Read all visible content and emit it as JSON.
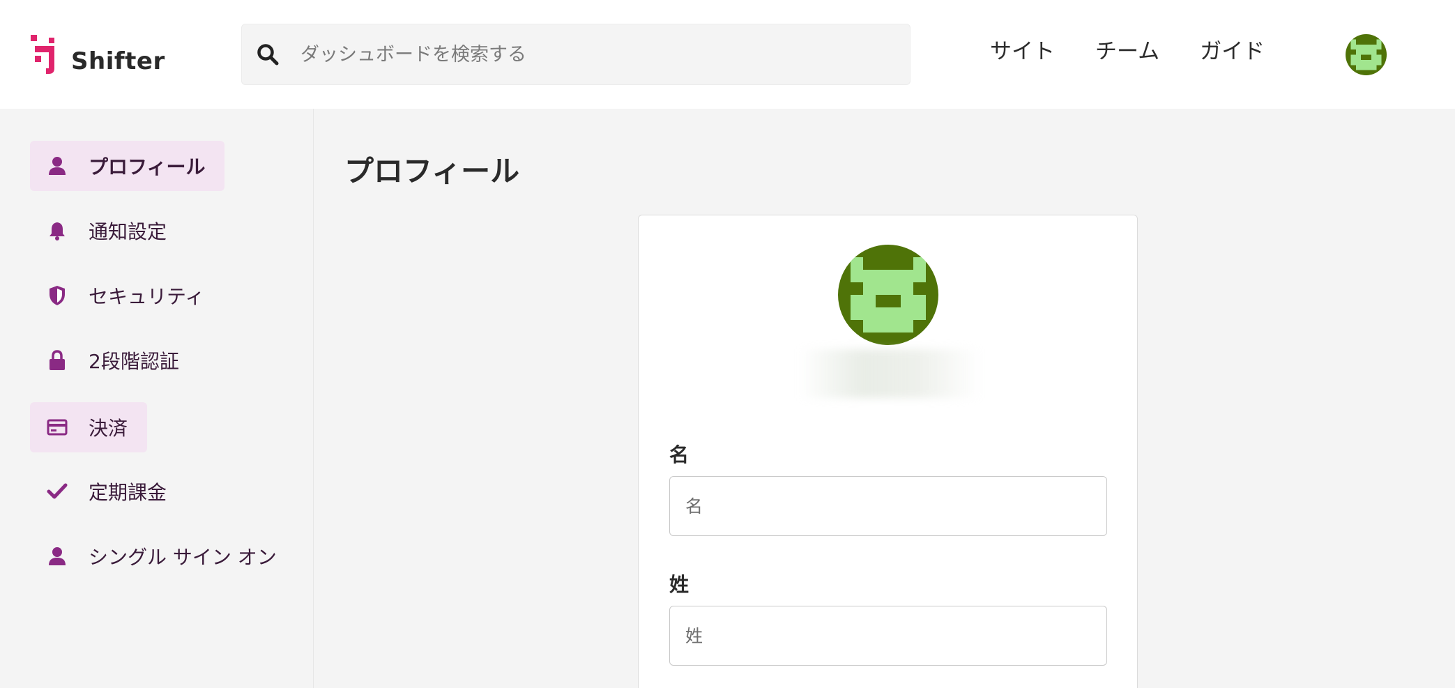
{
  "header": {
    "brand": "Shifter",
    "search_placeholder": "ダッシュボードを検索する",
    "nav": [
      "サイト",
      "チーム",
      "ガイド"
    ]
  },
  "sidebar": {
    "items": [
      {
        "label": "プロフィール",
        "icon": "user-icon",
        "state": "active"
      },
      {
        "label": "通知設定",
        "icon": "bell-icon",
        "state": "normal"
      },
      {
        "label": "セキュリティ",
        "icon": "shield-icon",
        "state": "normal"
      },
      {
        "label": "2段階認証",
        "icon": "lock-icon",
        "state": "normal"
      },
      {
        "label": "決済",
        "icon": "credit-card-icon",
        "state": "hover"
      },
      {
        "label": "定期課金",
        "icon": "check-icon",
        "state": "normal"
      },
      {
        "label": "シングル サイン オン",
        "icon": "user-icon",
        "state": "normal"
      }
    ]
  },
  "main": {
    "title": "プロフィール",
    "form": {
      "first_name": {
        "label": "名",
        "placeholder": "名",
        "value": ""
      },
      "last_name": {
        "label": "姓",
        "placeholder": "姓",
        "value": ""
      }
    }
  },
  "colors": {
    "accent": "#8a2a84",
    "active_bg": "#f3e4f2",
    "avatar_dark": "#4f7308",
    "avatar_light": "#a1e58e",
    "logo_pink": "#e0246c"
  }
}
